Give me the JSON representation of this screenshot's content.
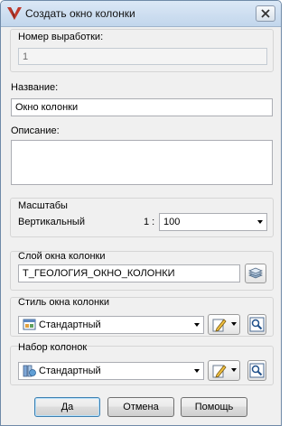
{
  "window": {
    "title": "Создать окно колонки"
  },
  "fields": {
    "bore_number": {
      "label": "Номер выработки:",
      "value": "1"
    },
    "name": {
      "label": "Название:",
      "value": "Окно колонки"
    },
    "description": {
      "label": "Описание:",
      "value": ""
    }
  },
  "scales": {
    "group_label": "Масштабы",
    "vertical_label": "Вертикальный",
    "ratio_prefix": "1 :",
    "vertical_value": "100"
  },
  "layer": {
    "label": "Слой окна колонки",
    "value": "Т_ГЕОЛОГИЯ_ОКНО_КОЛОНКИ"
  },
  "style": {
    "label": "Стиль окна колонки",
    "value": "Стандартный"
  },
  "column_set": {
    "label": "Набор колонок",
    "value": "Стандартный"
  },
  "buttons": {
    "ok": "Да",
    "cancel": "Отмена",
    "help": "Помощь"
  }
}
